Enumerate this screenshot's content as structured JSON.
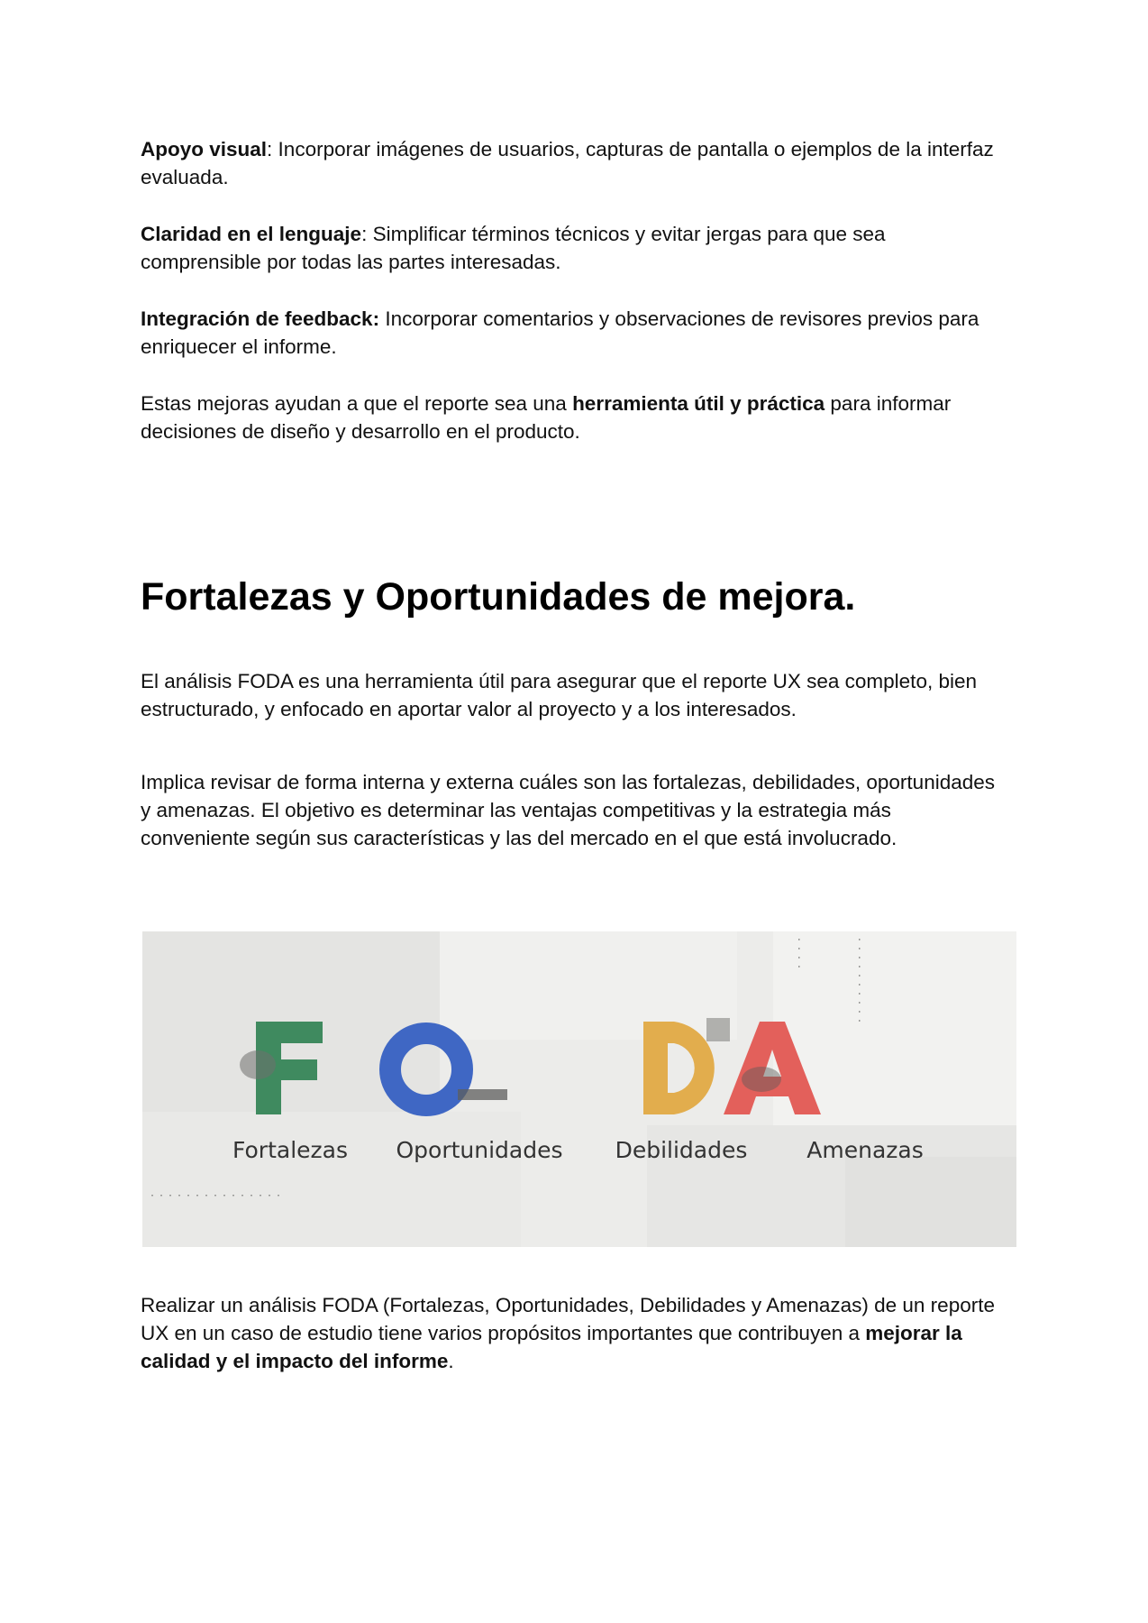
{
  "intro_items": [
    {
      "bold": "Apoyo visual",
      "text": ": Incorporar imágenes de usuarios, capturas de pantalla o ejemplos de la interfaz evaluada."
    },
    {
      "bold": "Claridad en el lenguaje",
      "text": ": Simplificar términos técnicos y evitar jergas para que sea comprensible por todas las partes interesadas."
    },
    {
      "bold": "Integración de feedback:",
      "text": " Incorporar comentarios y observaciones de revisores previos para enriquecer el informe."
    }
  ],
  "summary": {
    "before": "Estas mejoras ayudan a que el reporte sea una ",
    "bold": "herramienta útil y práctica",
    "after": " para informar decisiones de diseño y desarrollo en el producto."
  },
  "section": {
    "title": "Fortalezas y Oportunidades de mejora.",
    "paragraph1": "El análisis FODA es una herramienta útil para asegurar que el reporte UX sea completo, bien estructurado, y enfocado en aportar valor al proyecto y a los interesados.",
    "paragraph2": "Implica revisar de forma interna y externa cuáles son las fortalezas, debilidades, oportunidades y amenazas. El objetivo es determinar las ventajas competitivas y la estrategia más conveniente según sus características y las del mercado en el que está involucrado."
  },
  "foda_image": {
    "letters": [
      {
        "letter": "F",
        "word": "Fortalezas",
        "color": "#3f8a5f"
      },
      {
        "letter": "O",
        "word": "Oportunidades",
        "color": "#3f67c4"
      },
      {
        "letter": "D",
        "word": "Debilidades",
        "color": "#e2ad4d"
      },
      {
        "letter": "A",
        "word": "Amenazas",
        "color": "#e3605b"
      }
    ]
  },
  "closing": {
    "before": "Realizar un análisis FODA (Fortalezas, Oportunidades, Debilidades y Amenazas) de un reporte UX en un caso de estudio tiene varios propósitos importantes que contribuyen a ",
    "bold": "mejorar la calidad y el impacto del informe",
    "after": "."
  }
}
